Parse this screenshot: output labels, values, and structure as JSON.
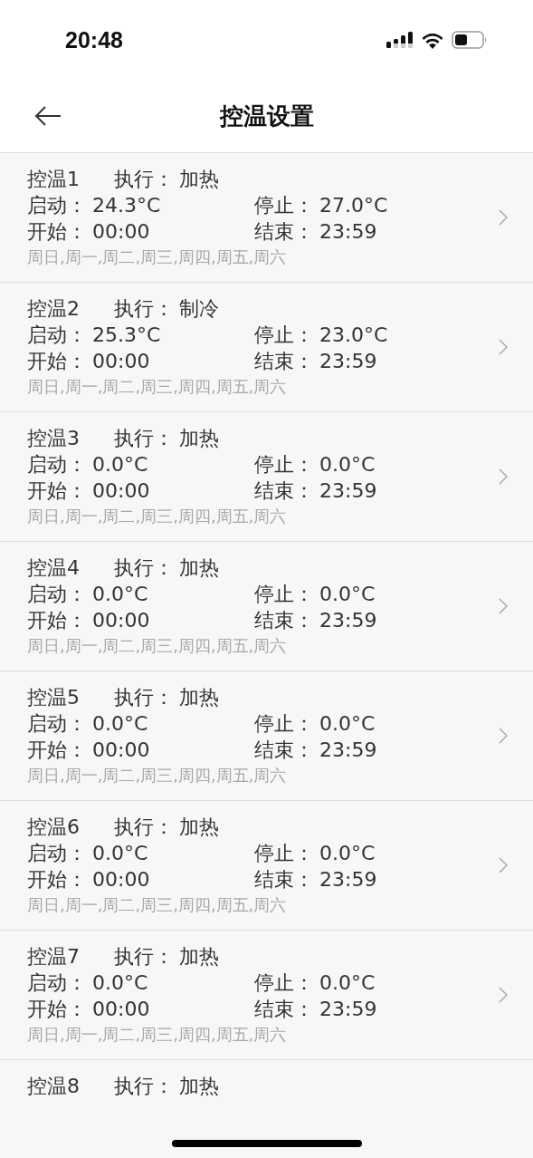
{
  "status_bar": {
    "time": "20:48"
  },
  "nav": {
    "title": "控温设置"
  },
  "rules": [
    {
      "title": "控温1",
      "mode_label": "执行：",
      "mode": "加热",
      "start_label": "启动：",
      "start": "24.3°C",
      "stop_label": "停止：",
      "stop": "27.0°C",
      "begin_label": "开始：",
      "begin": "00:00",
      "end_label": "结束：",
      "end": "23:59",
      "days": "周日,周一,周二,周三,周四,周五,周六"
    },
    {
      "title": "控温2",
      "mode_label": "执行：",
      "mode": "制冷",
      "start_label": "启动：",
      "start": "25.3°C",
      "stop_label": "停止：",
      "stop": "23.0°C",
      "begin_label": "开始：",
      "begin": "00:00",
      "end_label": "结束：",
      "end": "23:59",
      "days": "周日,周一,周二,周三,周四,周五,周六"
    },
    {
      "title": "控温3",
      "mode_label": "执行：",
      "mode": "加热",
      "start_label": "启动：",
      "start": "0.0°C",
      "stop_label": "停止：",
      "stop": "0.0°C",
      "begin_label": "开始：",
      "begin": "00:00",
      "end_label": "结束：",
      "end": "23:59",
      "days": "周日,周一,周二,周三,周四,周五,周六"
    },
    {
      "title": "控温4",
      "mode_label": "执行：",
      "mode": "加热",
      "start_label": "启动：",
      "start": "0.0°C",
      "stop_label": "停止：",
      "stop": "0.0°C",
      "begin_label": "开始：",
      "begin": "00:00",
      "end_label": "结束：",
      "end": "23:59",
      "days": "周日,周一,周二,周三,周四,周五,周六"
    },
    {
      "title": "控温5",
      "mode_label": "执行：",
      "mode": "加热",
      "start_label": "启动：",
      "start": "0.0°C",
      "stop_label": "停止：",
      "stop": "0.0°C",
      "begin_label": "开始：",
      "begin": "00:00",
      "end_label": "结束：",
      "end": "23:59",
      "days": "周日,周一,周二,周三,周四,周五,周六"
    },
    {
      "title": "控温6",
      "mode_label": "执行：",
      "mode": "加热",
      "start_label": "启动：",
      "start": "0.0°C",
      "stop_label": "停止：",
      "stop": "0.0°C",
      "begin_label": "开始：",
      "begin": "00:00",
      "end_label": "结束：",
      "end": "23:59",
      "days": "周日,周一,周二,周三,周四,周五,周六"
    },
    {
      "title": "控温7",
      "mode_label": "执行：",
      "mode": "加热",
      "start_label": "启动：",
      "start": "0.0°C",
      "stop_label": "停止：",
      "stop": "0.0°C",
      "begin_label": "开始：",
      "begin": "00:00",
      "end_label": "结束：",
      "end": "23:59",
      "days": "周日,周一,周二,周三,周四,周五,周六"
    },
    {
      "title": "控温8",
      "mode_label": "执行：",
      "mode": "加热"
    }
  ]
}
